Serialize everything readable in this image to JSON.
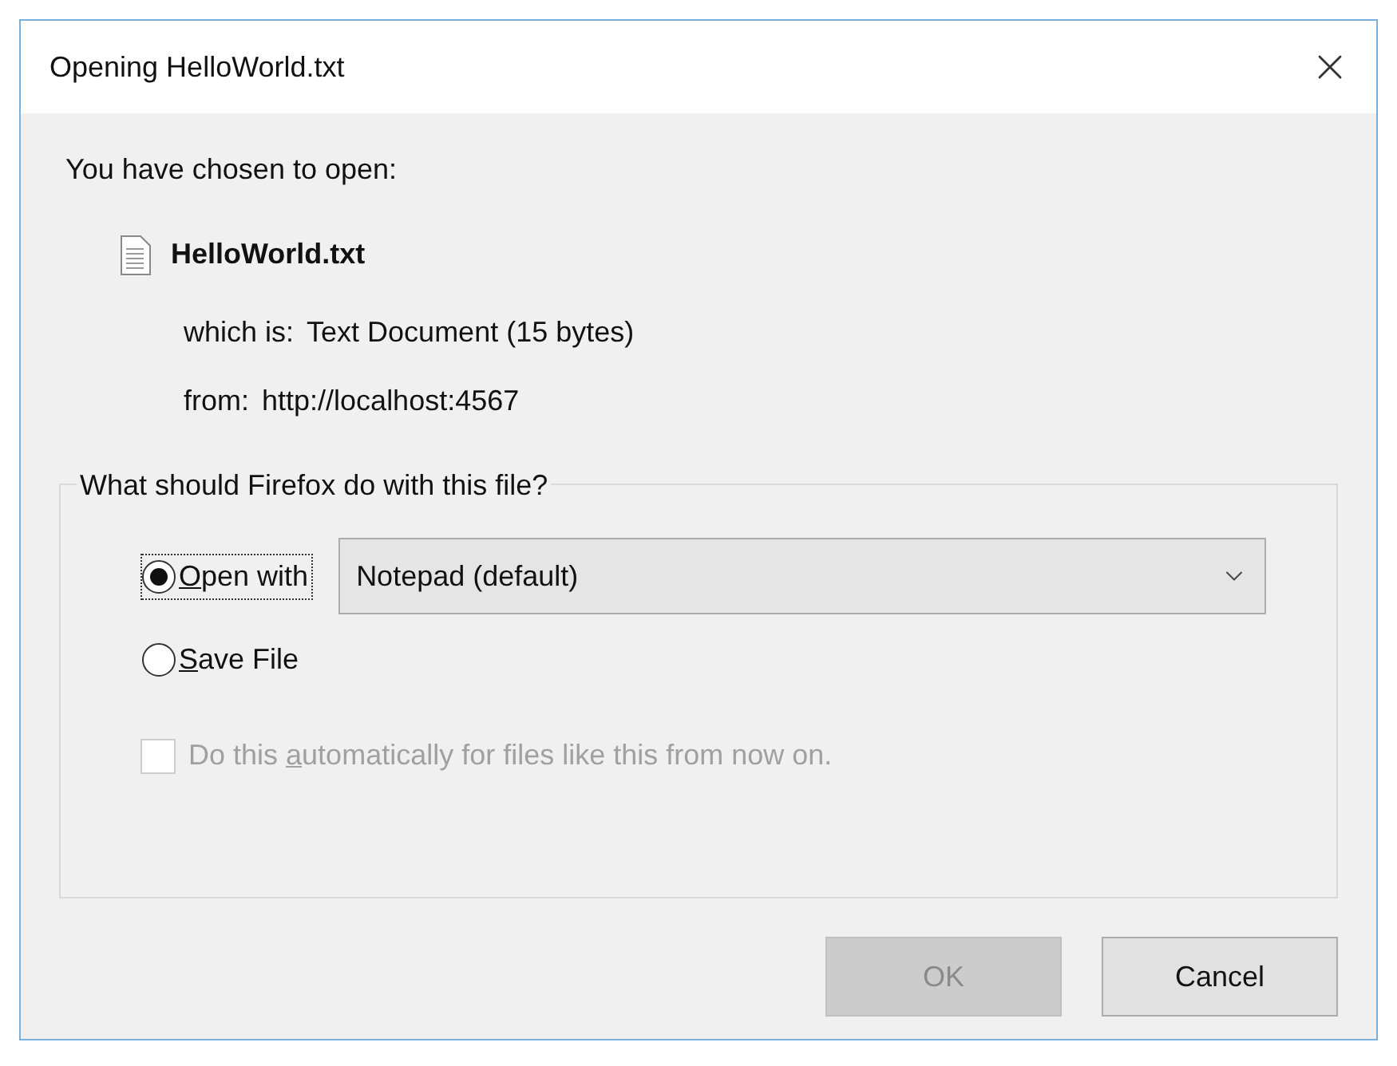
{
  "window": {
    "title": "Opening HelloWorld.txt"
  },
  "intro": "You have chosen to open:",
  "file": {
    "name": "HelloWorld.txt",
    "type_label": "which is:",
    "type_value": "Text Document (15 bytes)",
    "from_label": "from:",
    "from_value": "http://localhost:4567"
  },
  "group": {
    "label": "What should Firefox do with this file?",
    "options": [
      {
        "kind": "open",
        "key": "O",
        "after": "pen with",
        "selected": true,
        "focused": true,
        "app": "Notepad (default)"
      },
      {
        "kind": "save",
        "key": "S",
        "after": "ave File",
        "selected": false,
        "focused": false
      }
    ],
    "auto": {
      "before": "Do this ",
      "key": "a",
      "after": "utomatically for files like this from now on.",
      "checked": false,
      "disabled": true
    }
  },
  "buttons": [
    {
      "label": "OK",
      "disabled": true
    },
    {
      "label": "Cancel",
      "disabled": false
    }
  ]
}
